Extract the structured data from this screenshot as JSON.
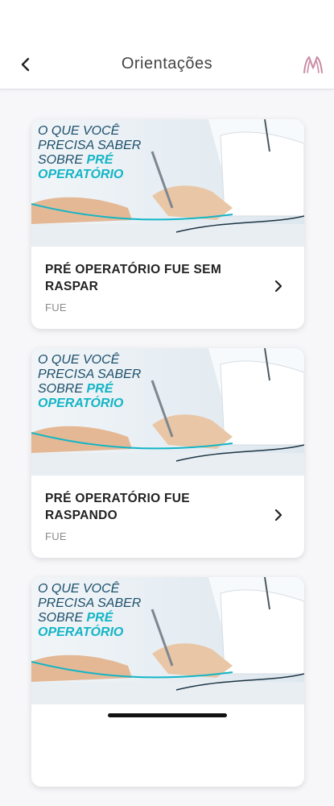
{
  "header": {
    "title": "Orientações",
    "back_icon": "chevron-left-icon",
    "logo_icon": "clinic-logo-icon",
    "accent": "#c98aa4"
  },
  "banner": {
    "line1": "O QUE VOCÊ",
    "line2": "PRECISA SABER",
    "line3_prefix": "SOBRE ",
    "line3_highlight": "PRÉ",
    "line4": "OPERATÓRIO"
  },
  "cards": [
    {
      "title": "PRÉ OPERATÓRIO FUE SEM RASPAR",
      "tag": "FUE"
    },
    {
      "title": "PRÉ OPERATÓRIO FUE RASPANDO",
      "tag": "FUE"
    },
    {
      "title": "",
      "tag": ""
    }
  ],
  "colors": {
    "teal": "#13b5c6",
    "navy": "#1c4f6b"
  }
}
